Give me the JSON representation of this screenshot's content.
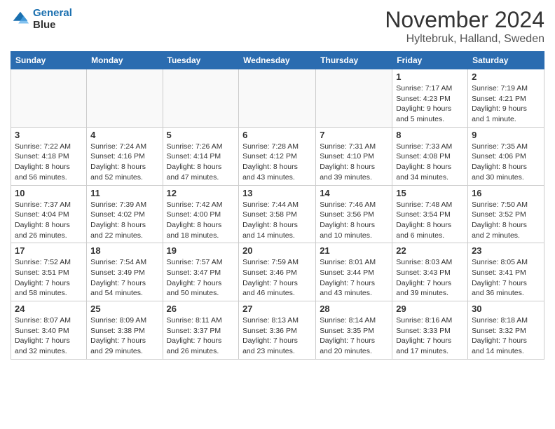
{
  "logo": {
    "line1": "General",
    "line2": "Blue"
  },
  "title": "November 2024",
  "subtitle": "Hyltebruk, Halland, Sweden",
  "days_of_week": [
    "Sunday",
    "Monday",
    "Tuesday",
    "Wednesday",
    "Thursday",
    "Friday",
    "Saturday"
  ],
  "weeks": [
    [
      {
        "day": "",
        "info": ""
      },
      {
        "day": "",
        "info": ""
      },
      {
        "day": "",
        "info": ""
      },
      {
        "day": "",
        "info": ""
      },
      {
        "day": "",
        "info": ""
      },
      {
        "day": "1",
        "info": "Sunrise: 7:17 AM\nSunset: 4:23 PM\nDaylight: 9 hours\nand 5 minutes."
      },
      {
        "day": "2",
        "info": "Sunrise: 7:19 AM\nSunset: 4:21 PM\nDaylight: 9 hours\nand 1 minute."
      }
    ],
    [
      {
        "day": "3",
        "info": "Sunrise: 7:22 AM\nSunset: 4:18 PM\nDaylight: 8 hours\nand 56 minutes."
      },
      {
        "day": "4",
        "info": "Sunrise: 7:24 AM\nSunset: 4:16 PM\nDaylight: 8 hours\nand 52 minutes."
      },
      {
        "day": "5",
        "info": "Sunrise: 7:26 AM\nSunset: 4:14 PM\nDaylight: 8 hours\nand 47 minutes."
      },
      {
        "day": "6",
        "info": "Sunrise: 7:28 AM\nSunset: 4:12 PM\nDaylight: 8 hours\nand 43 minutes."
      },
      {
        "day": "7",
        "info": "Sunrise: 7:31 AM\nSunset: 4:10 PM\nDaylight: 8 hours\nand 39 minutes."
      },
      {
        "day": "8",
        "info": "Sunrise: 7:33 AM\nSunset: 4:08 PM\nDaylight: 8 hours\nand 34 minutes."
      },
      {
        "day": "9",
        "info": "Sunrise: 7:35 AM\nSunset: 4:06 PM\nDaylight: 8 hours\nand 30 minutes."
      }
    ],
    [
      {
        "day": "10",
        "info": "Sunrise: 7:37 AM\nSunset: 4:04 PM\nDaylight: 8 hours\nand 26 minutes."
      },
      {
        "day": "11",
        "info": "Sunrise: 7:39 AM\nSunset: 4:02 PM\nDaylight: 8 hours\nand 22 minutes."
      },
      {
        "day": "12",
        "info": "Sunrise: 7:42 AM\nSunset: 4:00 PM\nDaylight: 8 hours\nand 18 minutes."
      },
      {
        "day": "13",
        "info": "Sunrise: 7:44 AM\nSunset: 3:58 PM\nDaylight: 8 hours\nand 14 minutes."
      },
      {
        "day": "14",
        "info": "Sunrise: 7:46 AM\nSunset: 3:56 PM\nDaylight: 8 hours\nand 10 minutes."
      },
      {
        "day": "15",
        "info": "Sunrise: 7:48 AM\nSunset: 3:54 PM\nDaylight: 8 hours\nand 6 minutes."
      },
      {
        "day": "16",
        "info": "Sunrise: 7:50 AM\nSunset: 3:52 PM\nDaylight: 8 hours\nand 2 minutes."
      }
    ],
    [
      {
        "day": "17",
        "info": "Sunrise: 7:52 AM\nSunset: 3:51 PM\nDaylight: 7 hours\nand 58 minutes."
      },
      {
        "day": "18",
        "info": "Sunrise: 7:54 AM\nSunset: 3:49 PM\nDaylight: 7 hours\nand 54 minutes."
      },
      {
        "day": "19",
        "info": "Sunrise: 7:57 AM\nSunset: 3:47 PM\nDaylight: 7 hours\nand 50 minutes."
      },
      {
        "day": "20",
        "info": "Sunrise: 7:59 AM\nSunset: 3:46 PM\nDaylight: 7 hours\nand 46 minutes."
      },
      {
        "day": "21",
        "info": "Sunrise: 8:01 AM\nSunset: 3:44 PM\nDaylight: 7 hours\nand 43 minutes."
      },
      {
        "day": "22",
        "info": "Sunrise: 8:03 AM\nSunset: 3:43 PM\nDaylight: 7 hours\nand 39 minutes."
      },
      {
        "day": "23",
        "info": "Sunrise: 8:05 AM\nSunset: 3:41 PM\nDaylight: 7 hours\nand 36 minutes."
      }
    ],
    [
      {
        "day": "24",
        "info": "Sunrise: 8:07 AM\nSunset: 3:40 PM\nDaylight: 7 hours\nand 32 minutes."
      },
      {
        "day": "25",
        "info": "Sunrise: 8:09 AM\nSunset: 3:38 PM\nDaylight: 7 hours\nand 29 minutes."
      },
      {
        "day": "26",
        "info": "Sunrise: 8:11 AM\nSunset: 3:37 PM\nDaylight: 7 hours\nand 26 minutes."
      },
      {
        "day": "27",
        "info": "Sunrise: 8:13 AM\nSunset: 3:36 PM\nDaylight: 7 hours\nand 23 minutes."
      },
      {
        "day": "28",
        "info": "Sunrise: 8:14 AM\nSunset: 3:35 PM\nDaylight: 7 hours\nand 20 minutes."
      },
      {
        "day": "29",
        "info": "Sunrise: 8:16 AM\nSunset: 3:33 PM\nDaylight: 7 hours\nand 17 minutes."
      },
      {
        "day": "30",
        "info": "Sunrise: 8:18 AM\nSunset: 3:32 PM\nDaylight: 7 hours\nand 14 minutes."
      }
    ]
  ]
}
